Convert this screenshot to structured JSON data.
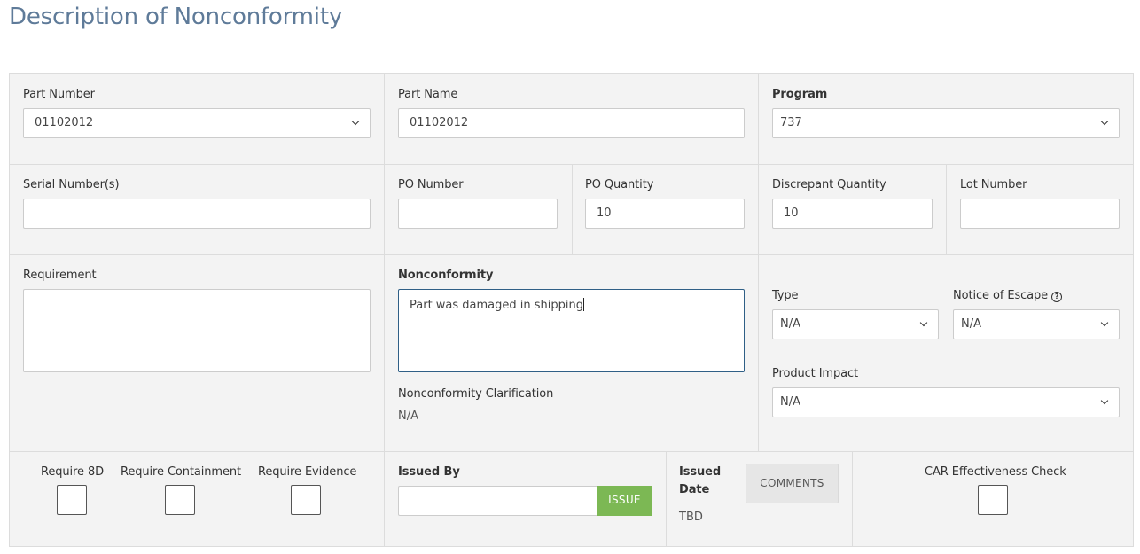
{
  "page": {
    "title": "Description of Nonconformity"
  },
  "part_number": {
    "label": "Part Number",
    "value": "01102012"
  },
  "part_name": {
    "label": "Part Name",
    "value": "01102012"
  },
  "program": {
    "label": "Program",
    "value": "737"
  },
  "serial_numbers": {
    "label": "Serial Number(s)",
    "value": ""
  },
  "po_number": {
    "label": "PO Number",
    "value": ""
  },
  "po_quantity": {
    "label": "PO Quantity",
    "value": "10"
  },
  "discrepant_quantity": {
    "label": "Discrepant Quantity",
    "value": "10"
  },
  "lot_number": {
    "label": "Lot Number",
    "value": ""
  },
  "requirement": {
    "label": "Requirement",
    "value": ""
  },
  "nonconformity": {
    "label": "Nonconformity",
    "value": "Part was damaged in shipping"
  },
  "clarification": {
    "label": "Nonconformity Clarification",
    "value": "N/A"
  },
  "type": {
    "label": "Type",
    "value": "N/A"
  },
  "notice_of_escape": {
    "label": "Notice of Escape",
    "value": "N/A",
    "icon": "help-circle-icon"
  },
  "product_impact": {
    "label": "Product Impact",
    "value": "N/A"
  },
  "require_8d": {
    "label": "Require 8D",
    "checked": false
  },
  "require_containment": {
    "label": "Require Containment",
    "checked": false
  },
  "require_evidence": {
    "label": "Require Evidence",
    "checked": false
  },
  "issued_by": {
    "label": "Issued By",
    "value": "",
    "button": "ISSUE"
  },
  "issued_date": {
    "label_line1": "Issued",
    "label_line2": "Date",
    "value": "TBD"
  },
  "comments": {
    "button": "COMMENTS"
  },
  "car_effectiveness": {
    "label": "CAR Effectiveness Check",
    "checked": false
  },
  "colors": {
    "title": "#5f7b99",
    "issue_button": "#7cb854",
    "panel_bg": "#f3f3f3",
    "focus_border": "#2f5f86"
  }
}
